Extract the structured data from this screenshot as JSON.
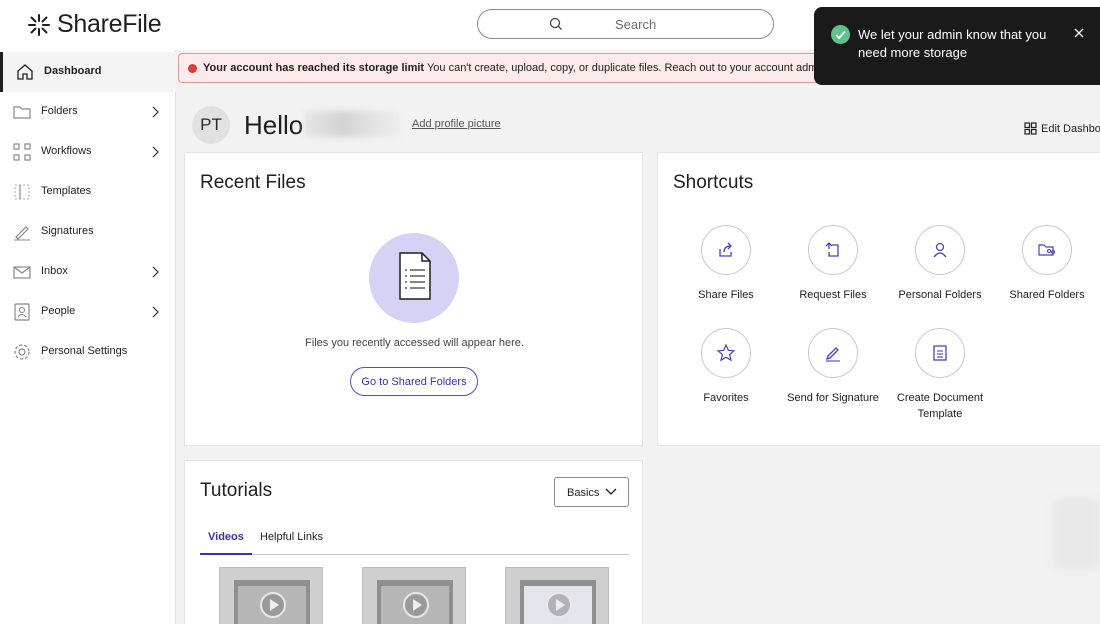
{
  "header": {
    "logo_text": "ShareFile",
    "search_placeholder": "Search"
  },
  "sidebar": {
    "items": [
      {
        "label": "Dashboard",
        "icon": "home-icon",
        "active": true,
        "has_chevron": false
      },
      {
        "label": "Folders",
        "icon": "folder-icon",
        "active": false,
        "has_chevron": true
      },
      {
        "label": "Workflows",
        "icon": "workflow-icon",
        "active": false,
        "has_chevron": true
      },
      {
        "label": "Templates",
        "icon": "template-icon",
        "active": false,
        "has_chevron": false
      },
      {
        "label": "Signatures",
        "icon": "signature-icon",
        "active": false,
        "has_chevron": false
      },
      {
        "label": "Inbox",
        "icon": "inbox-icon",
        "active": false,
        "has_chevron": true
      },
      {
        "label": "People",
        "icon": "people-icon",
        "active": false,
        "has_chevron": true
      },
      {
        "label": "Personal Settings",
        "icon": "gear-icon",
        "active": false,
        "has_chevron": false
      }
    ]
  },
  "alert": {
    "bold": "Your account has reached its storage limit",
    "text": " You can't create, upload, copy, or duplicate files. Reach out to your account admin t"
  },
  "greeting": {
    "avatar_initials": "PT",
    "hello": "Hello",
    "add_picture": "Add profile picture",
    "edit_dashboard": "Edit Dashbo"
  },
  "recent_files": {
    "title": "Recent Files",
    "empty_text": "Files you recently accessed will appear here.",
    "button_label": "Go to Shared Folders"
  },
  "shortcuts": {
    "title": "Shortcuts",
    "items": [
      {
        "label": "Share Files",
        "icon": "share-files-icon"
      },
      {
        "label": "Request Files",
        "icon": "request-files-icon"
      },
      {
        "label": "Personal Folders",
        "icon": "person-icon"
      },
      {
        "label": "Shared Folders",
        "icon": "shared-folder-icon"
      },
      {
        "label": "Favorites",
        "icon": "star-icon"
      },
      {
        "label": "Send for Signature",
        "icon": "pen-icon"
      },
      {
        "label": "Create Document Template",
        "icon": "document-template-icon"
      }
    ]
  },
  "tutorials": {
    "title": "Tutorials",
    "select_value": "Basics",
    "tabs": [
      "Videos",
      "Helpful Links"
    ],
    "active_tab": "Videos"
  },
  "toast": {
    "message": "We let your admin know that you need more storage"
  },
  "colors": {
    "accent": "#3d2fb0",
    "alert_bg": "#fbeaea",
    "alert_dot": "#d43f3a",
    "toast_bg": "#1a1a1a",
    "toast_check": "#5fc18a",
    "doc_circle": "#d6d2f6"
  }
}
